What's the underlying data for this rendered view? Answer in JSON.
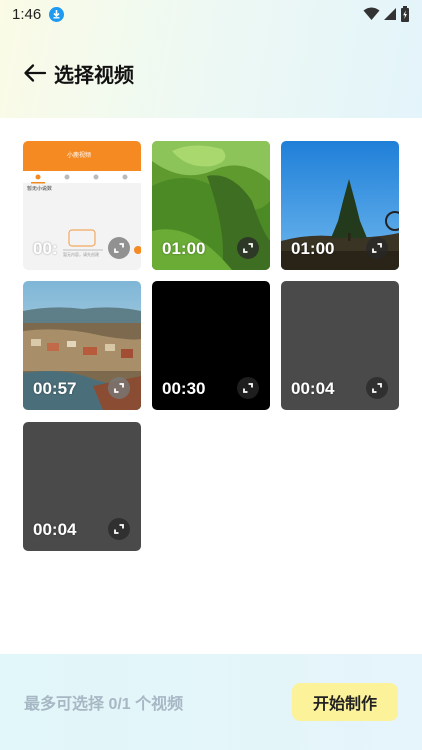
{
  "status_bar": {
    "time": "1:46"
  },
  "header": {
    "title": "选择视频"
  },
  "videos": [
    {
      "duration": "00:",
      "thumb": "app-screenshot"
    },
    {
      "duration": "01:00",
      "thumb": "green-hills"
    },
    {
      "duration": "01:00",
      "thumb": "blue-sky-tree"
    },
    {
      "duration": "00:57",
      "thumb": "coastal-town"
    },
    {
      "duration": "00:30",
      "thumb": "black"
    },
    {
      "duration": "00:04",
      "thumb": "gray"
    },
    {
      "duration": "00:04",
      "thumb": "gray"
    }
  ],
  "footer": {
    "selection_text": "最多可选择 0/1 个视频",
    "start_button": "开始制作"
  },
  "thumbnail_app": {
    "header_title": "小鹿视频",
    "subtitle": "暂无小说数",
    "empty_text": "暂无内容，请先创建"
  },
  "colors": {
    "accent_button": "#fbf29a",
    "app_orange": "#f58a23",
    "download_blue": "#1e9bf0"
  }
}
